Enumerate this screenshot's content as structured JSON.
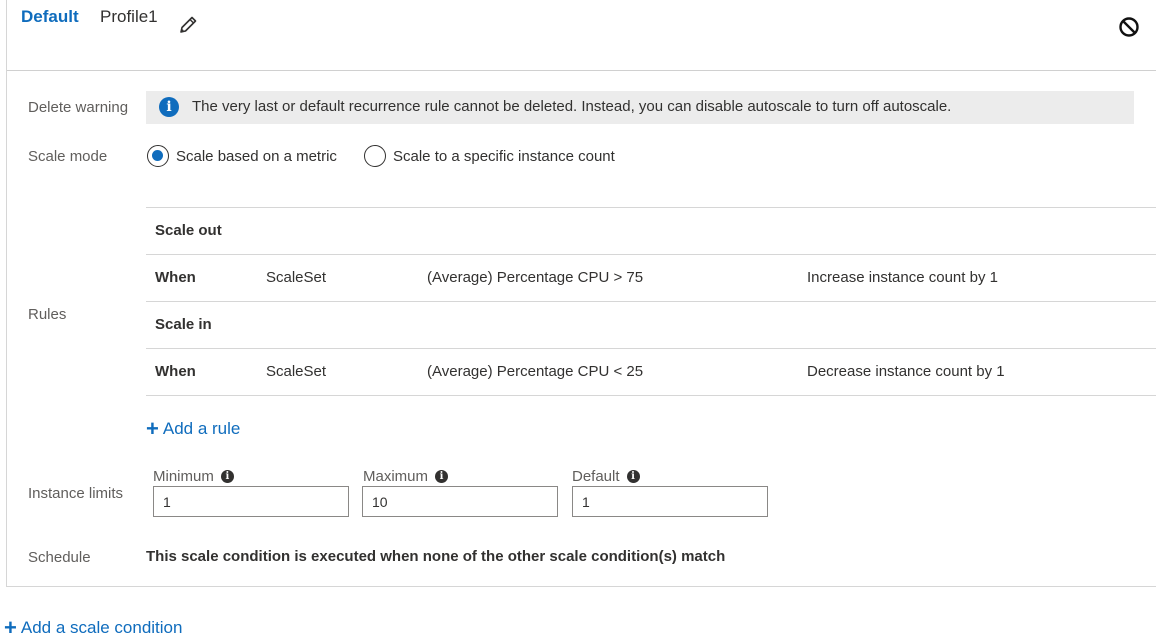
{
  "header": {
    "default_label": "Default",
    "profile_name": "Profile1",
    "edit_icon": "pencil-icon",
    "disable_icon": "block-icon"
  },
  "delete_warning": {
    "label": "Delete warning",
    "icon": "info-icon",
    "message": "The very last or default recurrence rule cannot be deleted. Instead, you can disable autoscale to turn off autoscale."
  },
  "scale_mode": {
    "label": "Scale mode",
    "options": [
      {
        "label": "Scale based on a metric",
        "selected": true
      },
      {
        "label": "Scale to a specific instance count",
        "selected": false
      }
    ]
  },
  "rules": {
    "label": "Rules",
    "scale_out": {
      "heading": "Scale out",
      "when": "When",
      "resource": "ScaleSet",
      "condition": "(Average) Percentage CPU > 75",
      "action": "Increase instance count by 1"
    },
    "scale_in": {
      "heading": "Scale in",
      "when": "When",
      "resource": "ScaleSet",
      "condition": "(Average) Percentage CPU < 25",
      "action": "Decrease instance count by 1"
    },
    "add_rule_label": "Add a rule"
  },
  "instance_limits": {
    "label": "Instance limits",
    "minimum_label": "Minimum",
    "minimum_value": "1",
    "maximum_label": "Maximum",
    "maximum_value": "10",
    "default_label": "Default",
    "default_value": "1"
  },
  "schedule": {
    "label": "Schedule",
    "text": "This scale condition is executed when none of the other scale condition(s) match"
  },
  "add_scale_condition_label": "Add a scale condition",
  "colors": {
    "accent": "#0f6cbd",
    "warning_bg": "#ececec",
    "text": "#323130",
    "label": "#605e5c"
  }
}
